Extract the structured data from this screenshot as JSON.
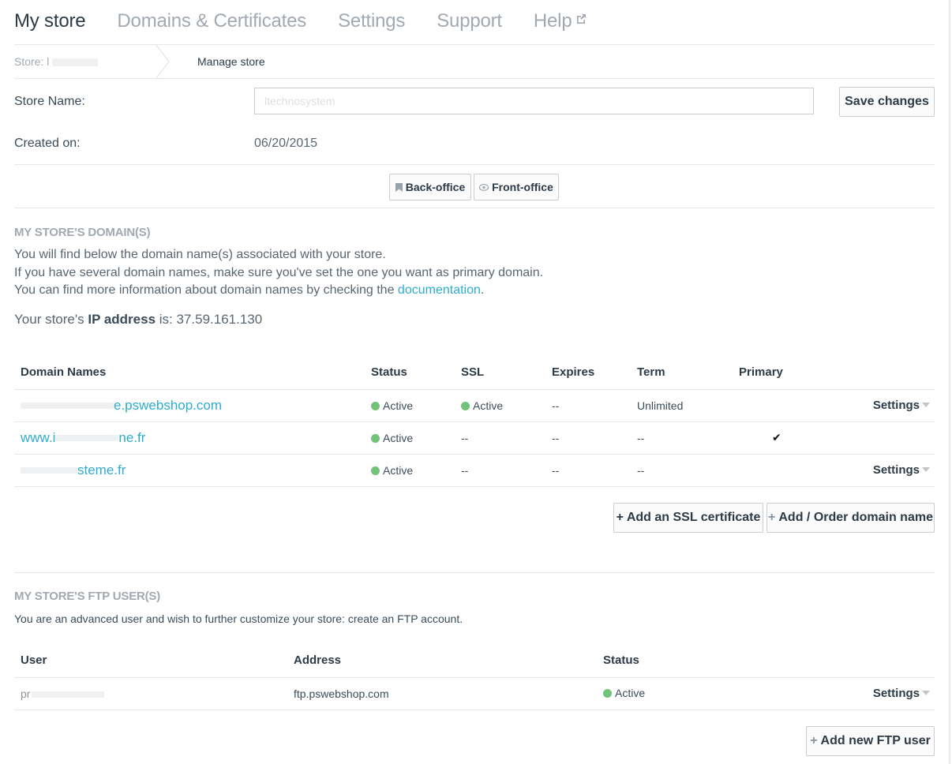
{
  "nav": {
    "items": [
      {
        "label": "My store",
        "active": true
      },
      {
        "label": "Domains & Certificates"
      },
      {
        "label": "Settings"
      },
      {
        "label": "Support"
      },
      {
        "label": "Help",
        "external": true
      }
    ]
  },
  "breadcrumb": {
    "store_label": "Store: l",
    "current": "Manage store"
  },
  "store": {
    "name_label": "Store Name:",
    "name_value": "ltechnosystem",
    "save_label": "Save changes",
    "created_label": "Created on:",
    "created_value": "06/20/2015"
  },
  "office": {
    "back_label": "Back-office",
    "front_label": "Front-office"
  },
  "domains_section": {
    "title": "MY STORE'S DOMAIN(S)",
    "line1": "You will find below the domain name(s) associated with your store.",
    "line2": "If you have several domain names, make sure you've set the one you want as primary domain.",
    "line3_prefix": "You can find more information about domain names by checking the ",
    "line3_link": "documentation",
    "line3_suffix": ".",
    "ip_prefix": "Your store's ",
    "ip_bold": "IP address",
    "ip_suffix": " is: 37.59.161.130",
    "headers": {
      "domain": "Domain Names",
      "status": "Status",
      "ssl": "SSL",
      "expires": "Expires",
      "term": "Term",
      "primary": "Primary"
    },
    "rows": [
      {
        "name_visible": "e.pswebshop.com",
        "status": "Active",
        "ssl": "Active",
        "expires": "--",
        "term": "Unlimited",
        "settings": "Settings"
      },
      {
        "name_prefix": "www.i",
        "name_suffix": "ne.fr",
        "status": "Active",
        "ssl": "--",
        "expires": "--",
        "term": "--",
        "primary_mark": "✔"
      },
      {
        "name_visible": "steme.fr",
        "status": "Active",
        "ssl": "--",
        "expires": "--",
        "term": "--",
        "settings": "Settings"
      }
    ],
    "add_ssl_label": "+ Add an SSL certificate",
    "add_domain_label": "Add / Order domain name"
  },
  "ftp_section": {
    "title": "MY STORE'S FTP USER(S)",
    "intro": "You are an advanced user and wish to further customize your store: create an FTP account.",
    "headers": {
      "user": "User",
      "address": "Address",
      "status": "Status"
    },
    "rows": [
      {
        "user_visible": "pr",
        "address": "ftp.pswebshop.com",
        "status": "Active",
        "settings": "Settings"
      }
    ],
    "add_label": "Add new FTP user"
  },
  "colors": {
    "accent_link": "#2eacce",
    "status_green": "#72c279",
    "nav_inactive": "#a2a9b0"
  }
}
